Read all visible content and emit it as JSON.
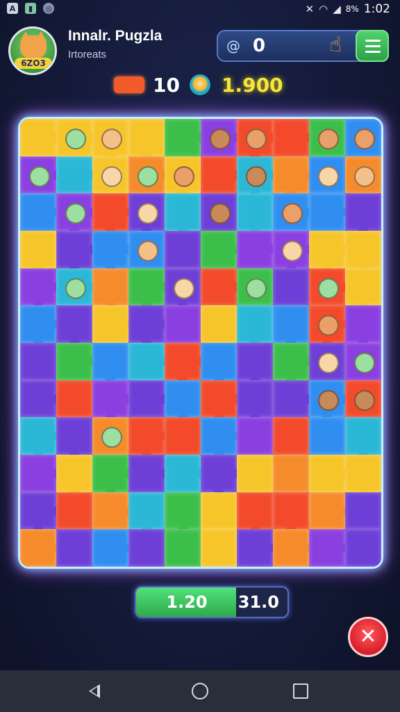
{
  "status_bar": {
    "left_icons": [
      "app-a-icon",
      "notification-icon",
      "sync-icon"
    ],
    "battery": "8%",
    "time": "1:02"
  },
  "header": {
    "title": "Innalr. Pugzla",
    "subtitle": "Irtoreats",
    "avatar_level": "6ZO3",
    "score_value": "0",
    "moves": "10",
    "coins": "1.900"
  },
  "board": {
    "rows": 12,
    "cols": 10,
    "palette": [
      "#6d3fd6",
      "#f24a2a",
      "#2f8ef0",
      "#f6c52a",
      "#3cbf4a",
      "#f58b2a",
      "#2bb7d6",
      "#8a3fe0"
    ],
    "accent_glow": "#6ad2ff"
  },
  "progress": {
    "current": "1.20",
    "total": "31.0",
    "fill_fraction": 0.66
  },
  "colors": {
    "accent_green": "#3cbf4a",
    "coin_yellow": "#f4e63a",
    "close_red": "#d81e2a"
  }
}
